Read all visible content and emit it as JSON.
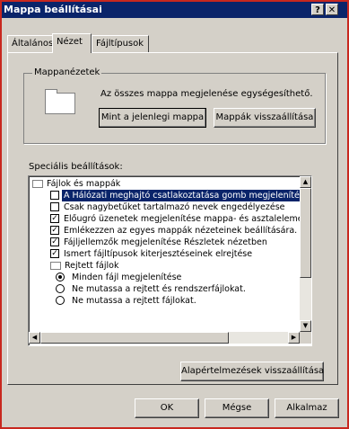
{
  "window": {
    "title": "Mappa beállításai",
    "help_glyph": "?",
    "close_glyph": "✕"
  },
  "tabs": [
    "Általános",
    "Nézet",
    "Fájltípusok"
  ],
  "folder_views": {
    "group_title": "Mappanézetek",
    "description": "Az összes mappa megjelenése egységesíthető.",
    "btn_current": "Mint a jelenlegi mappa",
    "btn_reset": "Mappák visszaállítása"
  },
  "advanced": {
    "label": "Speciális beállítások:",
    "items": [
      {
        "type": "folder",
        "indent": 0,
        "text": "Fájlok és mappák"
      },
      {
        "type": "checkbox",
        "indent": 1,
        "checked": false,
        "selected": true,
        "text": "A Hálózati meghajtó csatlakoztatása gomb megjelenítése"
      },
      {
        "type": "checkbox",
        "indent": 1,
        "checked": false,
        "text": "Csak nagybetűket tartalmazó nevek engedélyezése"
      },
      {
        "type": "checkbox",
        "indent": 1,
        "checked": true,
        "text": "Előugró üzenetek megjelenítése mappa- és asztalelemekhez"
      },
      {
        "type": "checkbox",
        "indent": 1,
        "checked": true,
        "text": "Emlékezzen az egyes mappák nézeteinek beállítására."
      },
      {
        "type": "checkbox",
        "indent": 1,
        "checked": true,
        "text": "Fájljellemzők megjelenítése Részletek nézetben"
      },
      {
        "type": "checkbox",
        "indent": 1,
        "checked": true,
        "text": "Ismert fájltípusok kiterjesztéseinek elrejtése"
      },
      {
        "type": "folder",
        "indent": 1,
        "text": "Rejtett fájlok"
      },
      {
        "type": "radio",
        "indent": 2,
        "checked": true,
        "text": "Minden fájl megjelenítése"
      },
      {
        "type": "radio",
        "indent": 2,
        "checked": false,
        "text": "Ne mutassa a rejtett és rendszerfájlokat."
      },
      {
        "type": "radio",
        "indent": 2,
        "checked": false,
        "text": "Ne mutassa a rejtett fájlokat."
      }
    ],
    "restore_defaults": "Alapértelmezések visszaállítása"
  },
  "footer": {
    "ok": "OK",
    "cancel": "Mégse",
    "apply": "Alkalmaz"
  }
}
